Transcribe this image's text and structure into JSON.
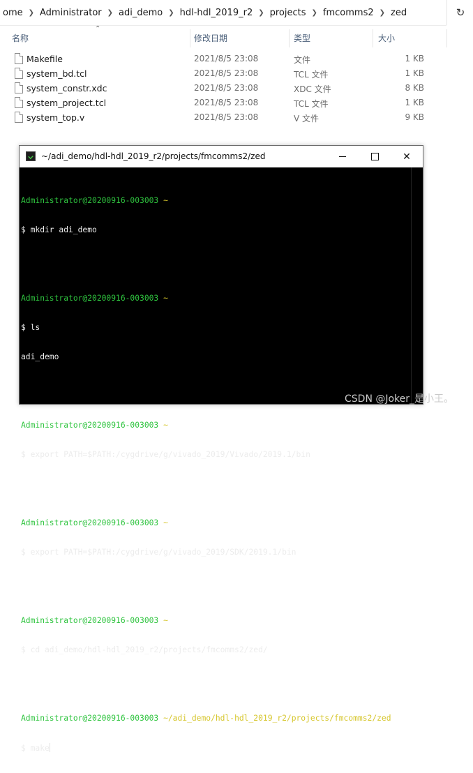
{
  "explorer": {
    "breadcrumb": [
      "ome",
      "Administrator",
      "adi_demo",
      "hdl-hdl_2019_r2",
      "projects",
      "fmcomms2",
      "zed"
    ],
    "columns": {
      "name": "名称",
      "modified": "修改日期",
      "type": "类型",
      "size": "大小"
    },
    "files": [
      {
        "name": "Makefile",
        "modified": "2021/8/5 23:08",
        "type": "文件",
        "size": "1 KB"
      },
      {
        "name": "system_bd.tcl",
        "modified": "2021/8/5 23:08",
        "type": "TCL 文件",
        "size": "1 KB"
      },
      {
        "name": "system_constr.xdc",
        "modified": "2021/8/5 23:08",
        "type": "XDC 文件",
        "size": "8 KB"
      },
      {
        "name": "system_project.tcl",
        "modified": "2021/8/5 23:08",
        "type": "TCL 文件",
        "size": "1 KB"
      },
      {
        "name": "system_top.v",
        "modified": "2021/8/5 23:08",
        "type": "V 文件",
        "size": "9 KB"
      }
    ]
  },
  "terminal": {
    "title": "~/adi_demo/hdl-hdl_2019_r2/projects/fmcomms2/zed",
    "blocks": [
      {
        "prompt_user": "Administrator@20200916-003003",
        "prompt_path": "~",
        "command": "$ mkdir adi_demo",
        "output": ""
      },
      {
        "prompt_user": "Administrator@20200916-003003",
        "prompt_path": "~",
        "command": "$ ls",
        "output": "adi_demo"
      },
      {
        "prompt_user": "Administrator@20200916-003003",
        "prompt_path": "~",
        "command": "$ export PATH=$PATH:/cygdrive/g/vivado_2019/Vivado/2019.1/bin",
        "output": ""
      },
      {
        "prompt_user": "Administrator@20200916-003003",
        "prompt_path": "~",
        "command": "$ export PATH=$PATH:/cygdrive/g/vivado_2019/SDK/2019.1/bin",
        "output": ""
      },
      {
        "prompt_user": "Administrator@20200916-003003",
        "prompt_path": "~",
        "command": "$ cd adi_demo/hdl-hdl_2019_r2/projects/fmcomms2/zed/",
        "output": ""
      },
      {
        "prompt_user": "Administrator@20200916-003003",
        "prompt_path": "~/adi_demo/hdl-hdl_2019_r2/projects/fmcomms2/zed",
        "command": "$ make",
        "output": ""
      }
    ],
    "colors": {
      "prompt_user": "#2fc43f",
      "prompt_path": "#d6c62c",
      "text": "#ececec",
      "background": "#000000"
    }
  },
  "watermark": "CSDN @Joker_是小王。"
}
